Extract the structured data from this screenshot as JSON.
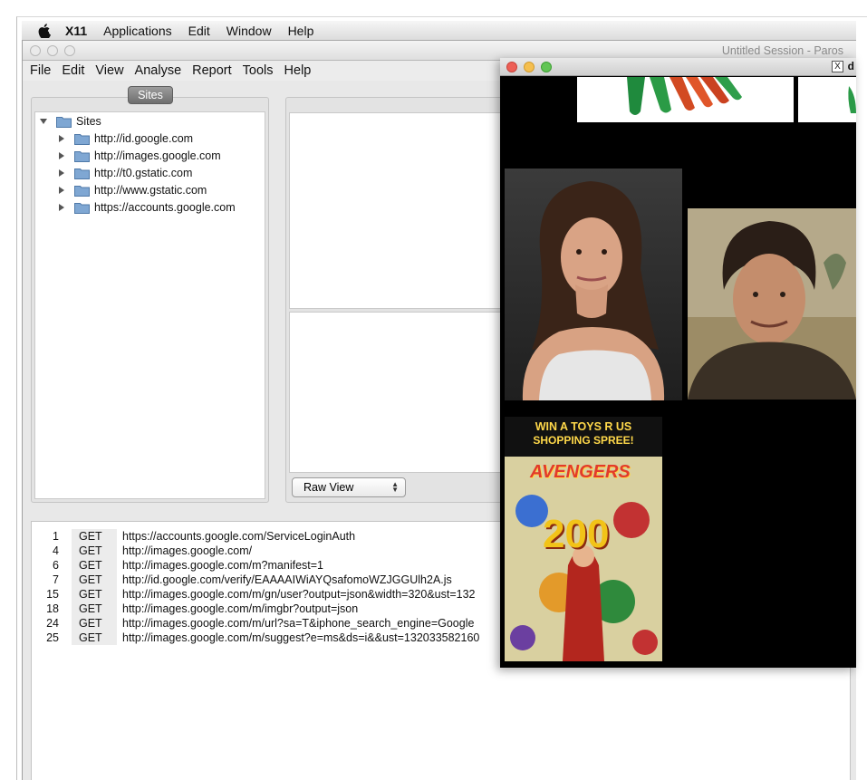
{
  "menubar": {
    "app_name": "X11",
    "items": [
      "Applications",
      "Edit",
      "Window",
      "Help"
    ]
  },
  "paros": {
    "title": "Untitled Session - Paros",
    "menu": [
      "File",
      "Edit",
      "View",
      "Analyse",
      "Report",
      "Tools",
      "Help"
    ],
    "sites_tab": "Sites",
    "tree": {
      "root": "Sites",
      "children": [
        "http://id.google.com",
        "http://images.google.com",
        "http://t0.gstatic.com",
        "http://www.gstatic.com",
        "https://accounts.google.com"
      ]
    },
    "view_select": "Raw View",
    "history": [
      {
        "id": "1",
        "method": "GET",
        "url": "https://accounts.google.com/ServiceLoginAuth"
      },
      {
        "id": "4",
        "method": "GET",
        "url": "http://images.google.com/"
      },
      {
        "id": "6",
        "method": "GET",
        "url": "http://images.google.com/m?manifest=1"
      },
      {
        "id": "7",
        "method": "GET",
        "url": "http://id.google.com/verify/EAAAAIWiAYQsafomoWZJGGUlh2A.js"
      },
      {
        "id": "15",
        "method": "GET",
        "url": "http://images.google.com/m/gn/user?output=json&width=320&ust=132"
      },
      {
        "id": "18",
        "method": "GET",
        "url": "http://images.google.com/m/imgbr?output=json"
      },
      {
        "id": "24",
        "method": "GET",
        "url": "http://images.google.com/m/url?sa=T&iphone_search_engine=Google"
      },
      {
        "id": "25",
        "method": "GET",
        "url": "http://images.google.com/m/suggest?e=ms&ds=i&&ust=132033582160"
      }
    ]
  },
  "xwindow": {
    "title_fragment": "d",
    "images": [
      {
        "name": "green-toy-image"
      },
      {
        "name": "woman-portrait-image"
      },
      {
        "name": "man-portrait-image"
      },
      {
        "name": "comic-cover-image",
        "cover_text": [
          "WIN A TOYS R US",
          "SHOPPING SPREE!",
          "AVENGERS",
          "200"
        ]
      }
    ]
  },
  "colors": {
    "traffic_red": "#ed5f56",
    "traffic_yellow": "#f5bf4f",
    "traffic_green": "#61c554",
    "folder_blue": "#7fa7d3",
    "sites_tab_gray": "#808080"
  }
}
